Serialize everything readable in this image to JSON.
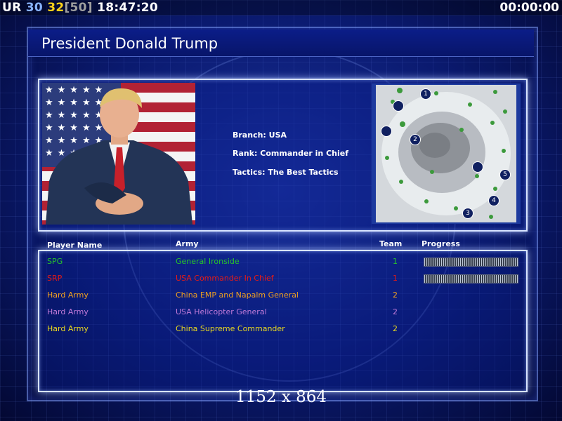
{
  "hud": {
    "ur": "UR",
    "val_a": "30",
    "val_b": "32",
    "bracket": "[50]",
    "clock": "18:47:20",
    "timer": "00:00:00"
  },
  "title": "President Donald Trump",
  "profile": {
    "branch": "Branch: USA",
    "rank": "Rank: Commander in Chief",
    "tactics": "Tactics: The Best Tactics"
  },
  "minimap": {
    "start_positions": [
      "1",
      "2",
      "3",
      "4",
      "5"
    ]
  },
  "columns": {
    "player": "Player Name",
    "army": "Army",
    "team": "Team",
    "progress": "Progress"
  },
  "players": [
    {
      "name": "SPG",
      "army": "General Ironside",
      "team": "1",
      "color": "#27c42a",
      "progress": 1.0
    },
    {
      "name": "SRP",
      "army": "USA Commander In Chief",
      "team": "1",
      "color": "#e81a14",
      "progress": 1.0
    },
    {
      "name": "Hard Army",
      "army": "China EMP and Napalm General",
      "team": "2",
      "color": "#f0a020"
    },
    {
      "name": "Hard Army",
      "army": "USA Helicopter General",
      "team": "2",
      "color": "#c07ad8"
    },
    {
      "name": "Hard Army",
      "army": "China Supreme Commander",
      "team": "2",
      "color": "#e8d820"
    }
  ],
  "resolution": "1152 x 864"
}
